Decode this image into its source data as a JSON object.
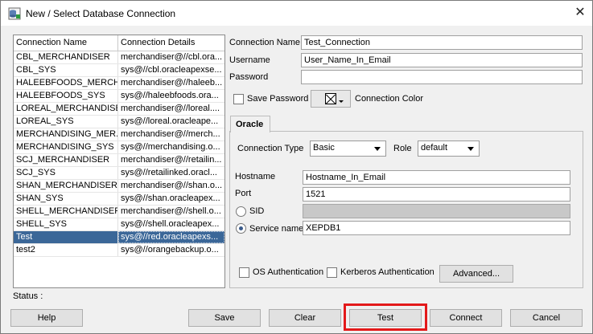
{
  "window": {
    "title": "New / Select Database Connection"
  },
  "connections": {
    "headers": {
      "name": "Connection Name",
      "details": "Connection Details"
    },
    "rows": [
      {
        "name": "CBL_MERCHANDISER",
        "details": "merchandiser@//cbl.ora..."
      },
      {
        "name": "CBL_SYS",
        "details": "sys@//cbl.oracleapexse..."
      },
      {
        "name": "HALEEBFOODS_MERCH...",
        "details": "merchandiser@//haleeb..."
      },
      {
        "name": "HALEEBFOODS_SYS",
        "details": "sys@//haleebfoods.ora..."
      },
      {
        "name": "LOREAL_MERCHANDISER",
        "details": "merchandiser@//loreal...."
      },
      {
        "name": "LOREAL_SYS",
        "details": "sys@//loreal.oracleape..."
      },
      {
        "name": "MERCHANDISING_MER...",
        "details": "merchandiser@//merch..."
      },
      {
        "name": "MERCHANDISING_SYS",
        "details": "sys@//merchandising.o..."
      },
      {
        "name": "SCJ_MERCHANDISER",
        "details": "merchandiser@//retailin..."
      },
      {
        "name": "SCJ_SYS",
        "details": "sys@//retailinked.oracl..."
      },
      {
        "name": "SHAN_MERCHANDISER",
        "details": "merchandiser@//shan.o..."
      },
      {
        "name": "SHAN_SYS",
        "details": "sys@//shan.oracleapex..."
      },
      {
        "name": "SHELL_MERCHANDISER",
        "details": "merchandiser@//shell.o..."
      },
      {
        "name": "SHELL_SYS",
        "details": "sys@//shell.oracleapex..."
      },
      {
        "name": "Test",
        "details": "sys@//red.oracleapexs...",
        "selected": true
      },
      {
        "name": "test2",
        "details": "sys@//orangebackup.o..."
      }
    ]
  },
  "form": {
    "connection_name": {
      "label": "Connection Name",
      "value": "Test_Connection"
    },
    "username": {
      "label": "Username",
      "value": "User_Name_In_Email"
    },
    "password": {
      "label": "Password",
      "value": ""
    },
    "save_password_label": "Save Password",
    "connection_color_label": "Connection Color",
    "tab_label": "Oracle",
    "connection_type": {
      "label": "Connection Type",
      "value": "Basic"
    },
    "role": {
      "label": "Role",
      "value": "default"
    },
    "hostname": {
      "label": "Hostname",
      "value": "Hostname_In_Email"
    },
    "port": {
      "label": "Port",
      "value": "1521"
    },
    "sid": {
      "label": "SID",
      "value": ""
    },
    "service_name": {
      "label": "Service name",
      "value": "XEPDB1"
    },
    "os_auth_label": "OS Authentication",
    "kerberos_auth_label": "Kerberos Authentication",
    "advanced_label": "Advanced..."
  },
  "status": {
    "label": "Status :"
  },
  "buttons": {
    "help": "Help",
    "save": "Save",
    "clear": "Clear",
    "test": "Test",
    "connect": "Connect",
    "cancel": "Cancel"
  },
  "colors": {
    "selection": "#3b6798",
    "highlight": "#e3191a"
  },
  "icons": {
    "app": "database-connection-icon",
    "close": "close-icon"
  }
}
